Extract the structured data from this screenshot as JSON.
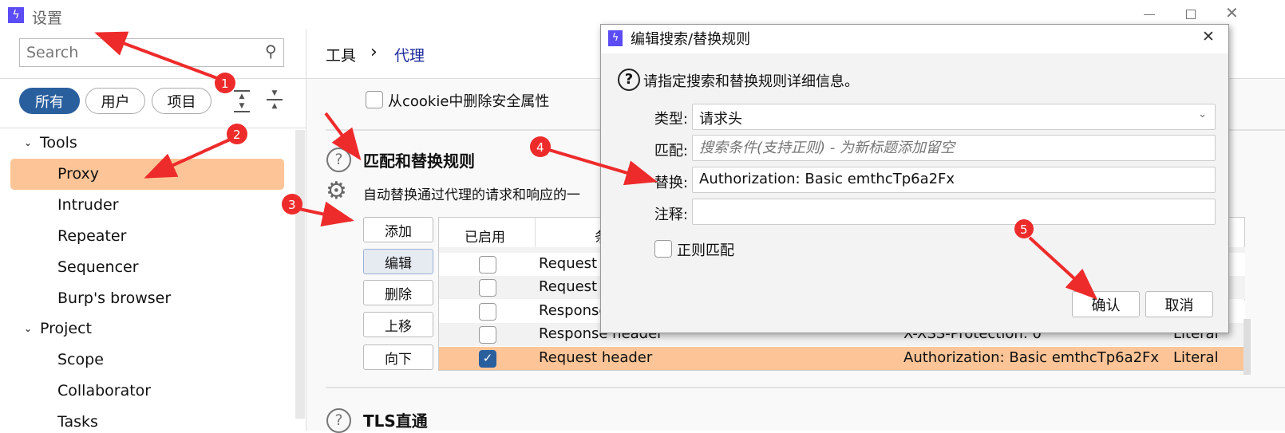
{
  "window": {
    "title": "设置",
    "app_icon": "burp-lightning-icon",
    "controls": [
      "minimize",
      "maximize",
      "close"
    ]
  },
  "sidebar": {
    "search": {
      "placeholder": "Search",
      "value": ""
    },
    "filters": [
      {
        "label": "所有",
        "active": true
      },
      {
        "label": "用户",
        "active": false
      },
      {
        "label": "项目",
        "active": false
      }
    ],
    "tree": [
      {
        "label": "Tools",
        "group": true
      },
      {
        "label": "Proxy",
        "selected": true
      },
      {
        "label": "Intruder"
      },
      {
        "label": "Repeater"
      },
      {
        "label": "Sequencer"
      },
      {
        "label": "Burp's browser"
      },
      {
        "label": "Project",
        "group": true
      },
      {
        "label": "Scope"
      },
      {
        "label": "Collaborator"
      },
      {
        "label": "Tasks"
      }
    ]
  },
  "breadcrumb": {
    "parent": "工具",
    "separator": "›",
    "current": "代理"
  },
  "main": {
    "cookie_checkbox": {
      "label": "从cookie中删除安全属性",
      "checked": false
    },
    "section": {
      "title": "匹配和替换规则",
      "description": "自动替换通过代理的请求和响应的一"
    },
    "buttons": [
      "添加",
      "编辑",
      "删除",
      "上移",
      "向下"
    ],
    "table": {
      "headers": [
        "已启用",
        "条"
      ],
      "rows": [
        {
          "enabled": false,
          "item": "Response header",
          "match": "",
          "type": ""
        },
        {
          "enabled": false,
          "item": "Request header",
          "match": "",
          "type": ""
        },
        {
          "enabled": false,
          "item": "Request header",
          "match": "",
          "type": ""
        },
        {
          "enabled": false,
          "item": "Response header",
          "match": "",
          "type": ""
        },
        {
          "enabled": false,
          "item": "Response header",
          "match": "X-XSS-Protection: 0",
          "type": "Literal"
        },
        {
          "enabled": true,
          "item": "Request header",
          "match": "Authorization: Basic emthcTp6a2Fx",
          "type": "Literal",
          "selected": true
        }
      ]
    },
    "next_section_title": "TLS直通"
  },
  "dialog": {
    "title": "编辑搜索/替换规则",
    "info": "请指定搜索和替换规则详细信息。",
    "type_label": "类型:",
    "type_value": "请求头",
    "match_label": "匹配:",
    "match_placeholder": "搜索条件(支持正则) - 为新标题添加留空",
    "replace_label": "替换:",
    "replace_value": "Authorization: Basic emthcTp6a2Fx",
    "comment_label": "注释:",
    "comment_value": "",
    "regex_label": "正则匹配",
    "regex_checked": false,
    "ok": "确认",
    "cancel": "取消"
  },
  "annotations": [
    "1",
    "2",
    "3",
    "4",
    "5"
  ],
  "colors": {
    "accent": "#2a5f9e",
    "selection": "#fdc597",
    "annotation": "#ee2b2b",
    "breadcrumb_current": "#1d2b9c",
    "app_icon": "#5b4cf5"
  }
}
